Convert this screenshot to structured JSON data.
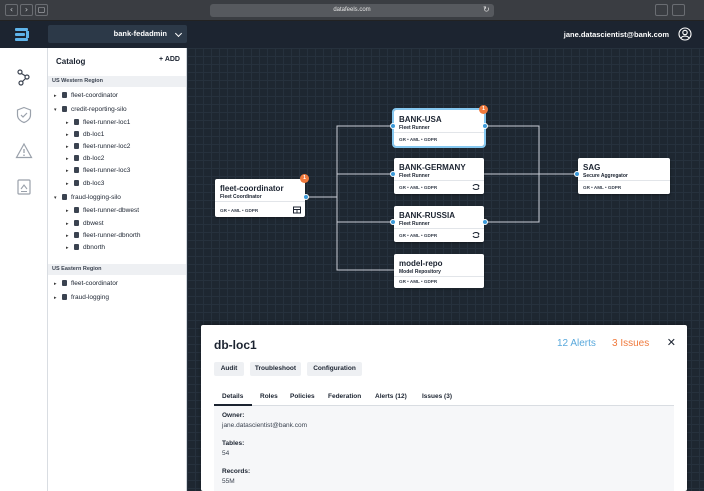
{
  "browser": {
    "url": "datafeels.com",
    "close_glyph": "‹",
    "forward_glyph": "›",
    "sidebar_glyph": "▢",
    "reload_glyph": "↻"
  },
  "header": {
    "tenant": "bank-fedadmin",
    "user_email": "jane.datascientist@bank.com"
  },
  "rail": {
    "icons": [
      "graph-icon",
      "shield-icon",
      "alert-icon",
      "document-icon"
    ]
  },
  "catalog": {
    "title": "Catalog",
    "add_label": "+ ADD",
    "regions": [
      {
        "name": "US Western Region",
        "items": [
          {
            "label": "fleet-coordinator",
            "toggle": "▸",
            "level": 0
          },
          {
            "label": "credit-reporting-silo",
            "toggle": "▾",
            "level": 0
          },
          {
            "label": "fleet-runner-loc1",
            "toggle": "▸",
            "level": 1
          },
          {
            "label": "db-loc1",
            "toggle": "▸",
            "level": 1
          },
          {
            "label": "fleet-runner-loc2",
            "toggle": "▸",
            "level": 1
          },
          {
            "label": "db-loc2",
            "toggle": "▸",
            "level": 1
          },
          {
            "label": "fleet-runner-loc3",
            "toggle": "▸",
            "level": 1
          },
          {
            "label": "db-loc3",
            "toggle": "▸",
            "level": 1
          },
          {
            "label": "fraud-logging-silo",
            "toggle": "▾",
            "level": 0
          },
          {
            "label": "fleet-runner-dbwest",
            "toggle": "▸",
            "level": 1
          },
          {
            "label": "dbwest",
            "toggle": "▸",
            "level": 1
          },
          {
            "label": "fleet-runner-dbnorth",
            "toggle": "▸",
            "level": 1
          },
          {
            "label": "dbnorth",
            "toggle": "▸",
            "level": 1
          }
        ]
      },
      {
        "name": "US Eastern Region",
        "items": [
          {
            "label": "fleet-coordinator",
            "toggle": "▸",
            "level": 0
          },
          {
            "label": "fraud-logging",
            "toggle": "▸",
            "level": 0
          }
        ]
      }
    ]
  },
  "graph": {
    "nodes": {
      "coordinator": {
        "title": "fleet-coordinator",
        "sub": "Fleet Coordinator",
        "tags": "GR • AML • GDPR",
        "badge": "1"
      },
      "bank_usa": {
        "title": "BANK-USA",
        "sub": "Fleet Runner",
        "tags": "GR • AML • GDPR",
        "badge": "1"
      },
      "bank_germany": {
        "title": "BANK-GERMANY",
        "sub": "Fleet Runner",
        "tags": "GR • AML • GDPR"
      },
      "bank_russia": {
        "title": "BANK-RUSSIA",
        "sub": "Fleet Runner",
        "tags": "GR • AML • GDPR"
      },
      "model_repo": {
        "title": "model-repo",
        "sub": "Model Repository",
        "tags": "GR • AML • GDPR"
      },
      "sag": {
        "title": "SAG",
        "sub": "Secure Aggregator",
        "tags": "GR • AML • GDPR"
      }
    },
    "colors": {
      "edge": "#c9ced6",
      "port": "#3b9ad9",
      "badge": "#f07a3d"
    }
  },
  "detail": {
    "title": "db-loc1",
    "alerts": "12 Alerts",
    "issues": "3 Issues",
    "close_glyph": "✕",
    "buttons": [
      "Audit",
      "Troubleshoot",
      "Configuration"
    ],
    "tabs": [
      "Details",
      "Roles",
      "Policies",
      "Federation",
      "Alerts (12)",
      "Issues (3)"
    ],
    "fields": [
      {
        "label": "Owner:",
        "value": "jane.datascientist@bank.com"
      },
      {
        "label": "Tables:",
        "value": "54"
      },
      {
        "label": "Records:",
        "value": "55M"
      }
    ]
  }
}
